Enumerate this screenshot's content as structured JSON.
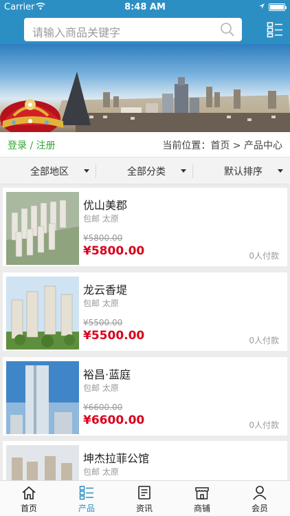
{
  "status_bar": {
    "carrier": "Carrier",
    "time": "8:48 AM"
  },
  "search": {
    "placeholder": "请输入商品关键字"
  },
  "header_bar": {
    "login_register": "登录 / 注册",
    "breadcrumb": "当前位置：首页 > 产品中心"
  },
  "filters": [
    {
      "label": "全部地区"
    },
    {
      "label": "全部分类"
    },
    {
      "label": "默认排序"
    }
  ],
  "products": [
    {
      "name": "优山美郡",
      "meta": "包邮 太原",
      "original_price": "¥5800.00",
      "price": "¥5800.00",
      "paid_count": "0人付款"
    },
    {
      "name": "龙云香堤",
      "meta": "包邮 太原",
      "original_price": "¥5500.00",
      "price": "¥5500.00",
      "paid_count": "0人付款"
    },
    {
      "name": "裕昌·蓝庭",
      "meta": "包邮 太原",
      "original_price": "¥6600.00",
      "price": "¥6600.00",
      "paid_count": "0人付款"
    },
    {
      "name": "坤杰拉菲公馆",
      "meta": "包邮 太原",
      "original_price": "",
      "price": "",
      "paid_count": ""
    }
  ],
  "tabs": [
    {
      "label": "首页",
      "icon": "home-icon",
      "active": false
    },
    {
      "label": "产品",
      "icon": "list-icon",
      "active": true
    },
    {
      "label": "资讯",
      "icon": "news-icon",
      "active": false
    },
    {
      "label": "商铺",
      "icon": "store-icon",
      "active": false
    },
    {
      "label": "会员",
      "icon": "user-icon",
      "active": false
    }
  ],
  "colors": {
    "brand": "#2c8fc4",
    "price": "#d9001b",
    "login": "#33a533"
  }
}
